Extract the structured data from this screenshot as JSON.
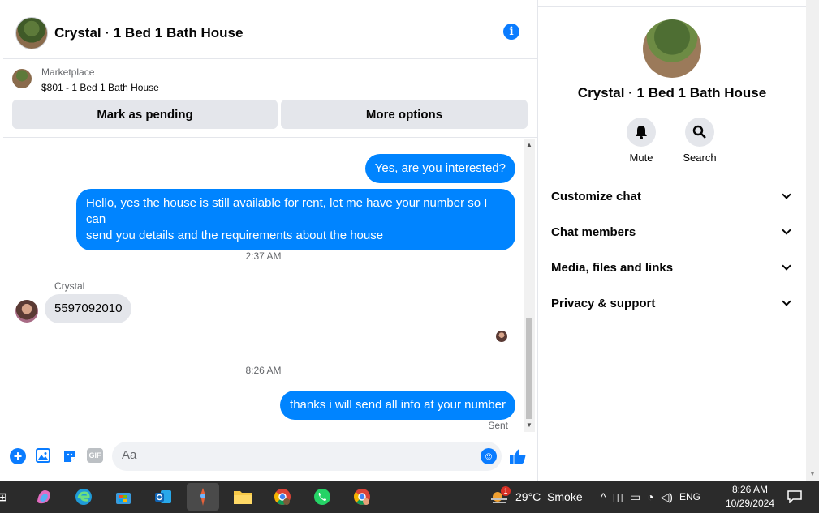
{
  "chat": {
    "title": "Crystal · 1 Bed 1 Bath House",
    "marketplace_label": "Marketplace",
    "listing": "$801 - 1 Bed 1 Bath House",
    "mark_pending": "Mark as pending",
    "more_options": "More options"
  },
  "messages": {
    "out1": "Yes, are you interested?",
    "out2_line1": "Hello, yes the house is still available for rent, let me have your number so I can",
    "out2_line2": "send you details and the requirements about the house",
    "time1": "2:37 AM",
    "sender": "Crystal",
    "in1": "5597092010",
    "time2": "8:26 AM",
    "out3": "thanks i will send all info at your number",
    "sent": "Sent"
  },
  "composer": {
    "placeholder": "Aa",
    "gif": "GIF"
  },
  "side": {
    "title": "Crystal · 1 Bed 1 Bath House",
    "mute": "Mute",
    "search": "Search",
    "rows": [
      "Customize chat",
      "Chat members",
      "Media, files and links",
      "Privacy & support"
    ]
  },
  "taskbar": {
    "weather": "29°C  Smoke",
    "lang": "ENG",
    "time": "8:26 AM",
    "date": "10/29/2024",
    "weather_badge": "1"
  }
}
